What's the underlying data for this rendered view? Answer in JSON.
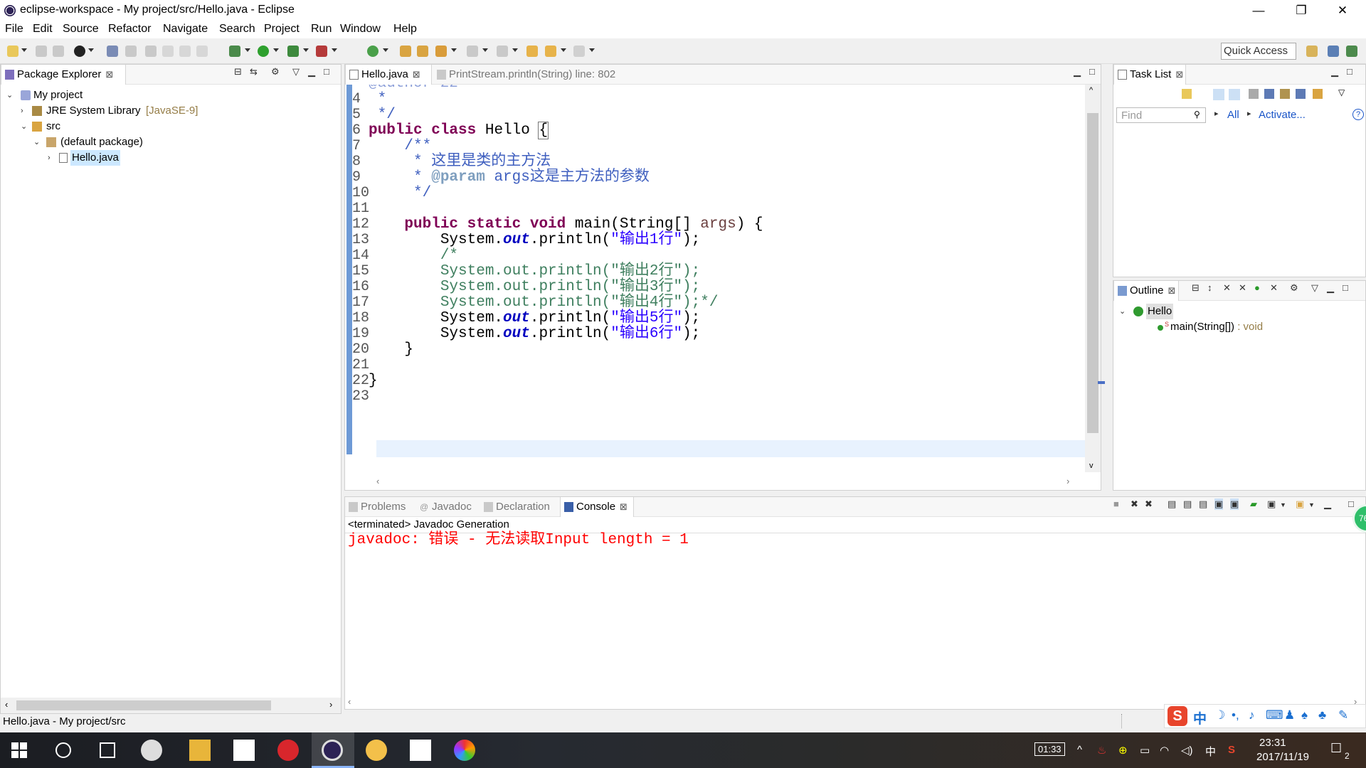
{
  "window": {
    "title": "eclipse-workspace - My project/src/Hello.java - Eclipse",
    "minimize": "—",
    "restore": "❐",
    "close": "✕"
  },
  "menu": [
    "File",
    "Edit",
    "Source",
    "Refactor",
    "Navigate",
    "Search",
    "Project",
    "Run",
    "Window",
    "Help"
  ],
  "toolbar": {
    "quick_access": "Quick Access"
  },
  "package_explorer": {
    "tab_label": "Package Explorer",
    "tree": {
      "project": "My project",
      "jre": "JRE System Library",
      "jre_version": "[JavaSE-9]",
      "src": "src",
      "package": "(default package)",
      "file": "Hello.java"
    }
  },
  "editor": {
    "tabs": [
      {
        "label": "Hello.java",
        "active": true
      },
      {
        "label": "PrintStream.println(String) line: 802",
        "active": false
      }
    ],
    "partial_top_line": "@author zz",
    "lines": [
      {
        "num": "4"
      },
      {
        "num": "5"
      },
      {
        "num": "6"
      },
      {
        "num": "7"
      },
      {
        "num": "8"
      },
      {
        "num": "9"
      },
      {
        "num": "10"
      },
      {
        "num": "11"
      },
      {
        "num": "12"
      },
      {
        "num": "13"
      },
      {
        "num": "14"
      },
      {
        "num": "15"
      },
      {
        "num": "16"
      },
      {
        "num": "17"
      },
      {
        "num": "18"
      },
      {
        "num": "19"
      },
      {
        "num": "20"
      },
      {
        "num": "21"
      },
      {
        "num": "22"
      },
      {
        "num": "23"
      }
    ],
    "code": {
      "l4": " *",
      "l5": " */",
      "l6_kw": "public class",
      "l6_name": " Hello ",
      "l6_brace": "{",
      "l7": "    /**",
      "l8": "     * 这里是类的主方法",
      "l9_a": "     * ",
      "l9_tag": "@param",
      "l9_b": " args这是主方法的参数",
      "l10": "     */",
      "l12_kw": "    public static void",
      "l12_rest": " main(String[] ",
      "l12_par": "args",
      "l12_end": ") {",
      "l13_a": "        System.",
      "l13_out": "out",
      "l13_b": ".println(",
      "l13_s": "\"输出1行\"",
      "l13_c": ");",
      "l14": "        /*",
      "l15": "        System.out.println(\"输出2行\");",
      "l16": "        System.out.println(\"输出3行\");",
      "l17": "        System.out.println(\"输出4行\");*/",
      "l18_a": "        System.",
      "l18_out": "out",
      "l18_b": ".println(",
      "l18_s": "\"输出5行\"",
      "l18_c": ");",
      "l19_a": "        System.",
      "l19_out": "out",
      "l19_b": ".println(",
      "l19_s": "\"输出6行\"",
      "l19_c": ");",
      "l20": "    }",
      "l22": "}"
    }
  },
  "task_list": {
    "tab_label": "Task List",
    "find_placeholder": "Find",
    "all": "All",
    "activate": "Activate..."
  },
  "outline": {
    "tab_label": "Outline",
    "class": "Hello",
    "method": "main(String[])",
    "method_type": " : void"
  },
  "bottom": {
    "tabs": [
      "Problems",
      "Javadoc",
      "Declaration",
      "Console"
    ],
    "console_header": "<terminated> Javadoc Generation",
    "console_output": "javadoc: 错误 - 无法读取Input length = 1",
    "badge": "76"
  },
  "status": {
    "text": "Hello.java - My project/src"
  },
  "ime": {
    "label": "中"
  },
  "taskbar": {
    "badge": "01:33",
    "lang": "中",
    "time": "23:31",
    "date": "2017/11/19",
    "notif": "2"
  },
  "colors": {
    "keyword": "#7f0055",
    "comment": "#3f5fbf",
    "line_comment": "#3f7f5f",
    "string": "#2a00ff",
    "console_error": "#ff0000"
  }
}
